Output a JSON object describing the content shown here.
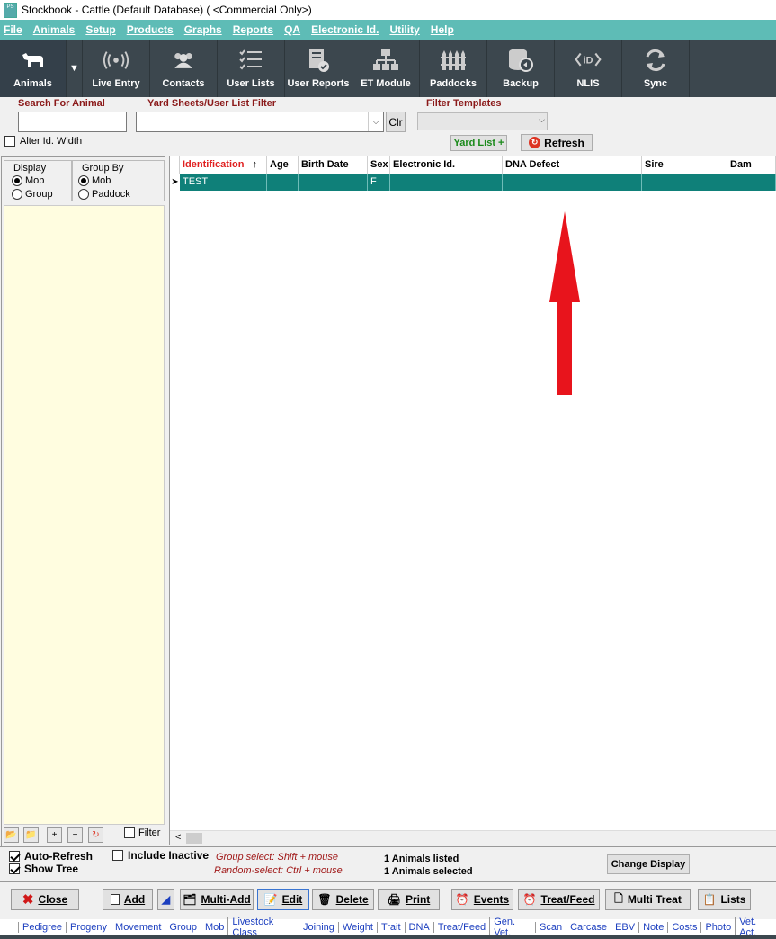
{
  "window": {
    "title": "Stockbook - Cattle (Default Database) ( <Commercial Only>)",
    "icon_text": "PS"
  },
  "menu": [
    "File",
    "Animals",
    "Setup",
    "Products",
    "Graphs",
    "Reports",
    "QA",
    "Electronic Id.",
    "Utility",
    "Help"
  ],
  "toolbar": {
    "items": [
      {
        "label": "Animals",
        "icon": "cow-icon"
      },
      {
        "label": "Live Entry",
        "icon": "broadcast-icon"
      },
      {
        "label": "Contacts",
        "icon": "people-icon"
      },
      {
        "label": "User Lists",
        "icon": "list-check-icon"
      },
      {
        "label": "User Reports",
        "icon": "report-icon"
      },
      {
        "label": "ET Module",
        "icon": "hierarchy-icon"
      },
      {
        "label": "Paddocks",
        "icon": "fence-icon"
      },
      {
        "label": "Backup",
        "icon": "database-backup-icon"
      },
      {
        "label": "NLIS",
        "icon": "nlis-tag-icon"
      },
      {
        "label": "Sync",
        "icon": "sync-icon"
      }
    ]
  },
  "search": {
    "label": "Search For Animal",
    "value": ""
  },
  "yard_filter": {
    "label": "Yard Sheets/User List Filter",
    "value": "",
    "clear_label": "Clr"
  },
  "filter_templates": {
    "label": "Filter Templates",
    "value": ""
  },
  "alter_id": {
    "label": "Alter Id. Width",
    "checked": false
  },
  "yard_list_button": "Yard List +",
  "refresh_button": "Refresh",
  "display_group": {
    "title": "Display",
    "options": [
      "Mob",
      "Group"
    ],
    "selected": "Mob"
  },
  "groupby_group": {
    "title": "Group By",
    "options": [
      "Mob",
      "Paddock"
    ],
    "selected": "Mob"
  },
  "sidebar_filter_label": "Filter",
  "grid": {
    "columns": [
      "Identification",
      "Age",
      "Birth Date",
      "Sex",
      "Electronic Id.",
      "DNA Defect",
      "Sire",
      "Dam"
    ],
    "sort_indicator": "↑",
    "rows": [
      {
        "Identification": "TEST",
        "Age": "",
        "Birth Date": "",
        "Sex": "F",
        "Electronic Id.": "",
        "DNA Defect": "",
        "Sire": "",
        "Dam": ""
      }
    ]
  },
  "options": {
    "auto_refresh": {
      "label": "Auto-Refresh",
      "checked": true
    },
    "show_tree": {
      "label": "Show Tree",
      "checked": true
    },
    "include_inactive": {
      "label": "Include Inactive",
      "checked": false
    }
  },
  "hints": {
    "group_select": "Group select: Shift + mouse",
    "random_select": "Random-select: Ctrl + mouse"
  },
  "status": {
    "listed": "1 Animals listed",
    "selected": "1 Animals selected"
  },
  "change_display_button": "Change Display",
  "bottom_buttons": {
    "close": "Close",
    "add": "Add",
    "multi_add": "Multi-Add",
    "edit": "Edit",
    "delete": "Delete",
    "print": "Print",
    "events": "Events",
    "treat_feed": "Treat/Feed",
    "multi_treat": "Multi Treat",
    "lists": "Lists"
  },
  "tabs": [
    "Pedigree",
    "Progeny",
    "Movement",
    "Group",
    "Mob",
    "Livestock Class",
    "Joining",
    "Weight",
    "Trait",
    "DNA",
    "Treat/Feed",
    "Gen. Vet.",
    "Scan",
    "Carcase",
    "EBV",
    "Note",
    "Costs",
    "Photo",
    "Vet. Act."
  ],
  "colors": {
    "teal_menu": "#5ebcb6",
    "toolbar": "#3c474e",
    "row_selected": "#0f8079",
    "sidebar_bg": "#fffde0",
    "arrow": "#e8141c"
  }
}
